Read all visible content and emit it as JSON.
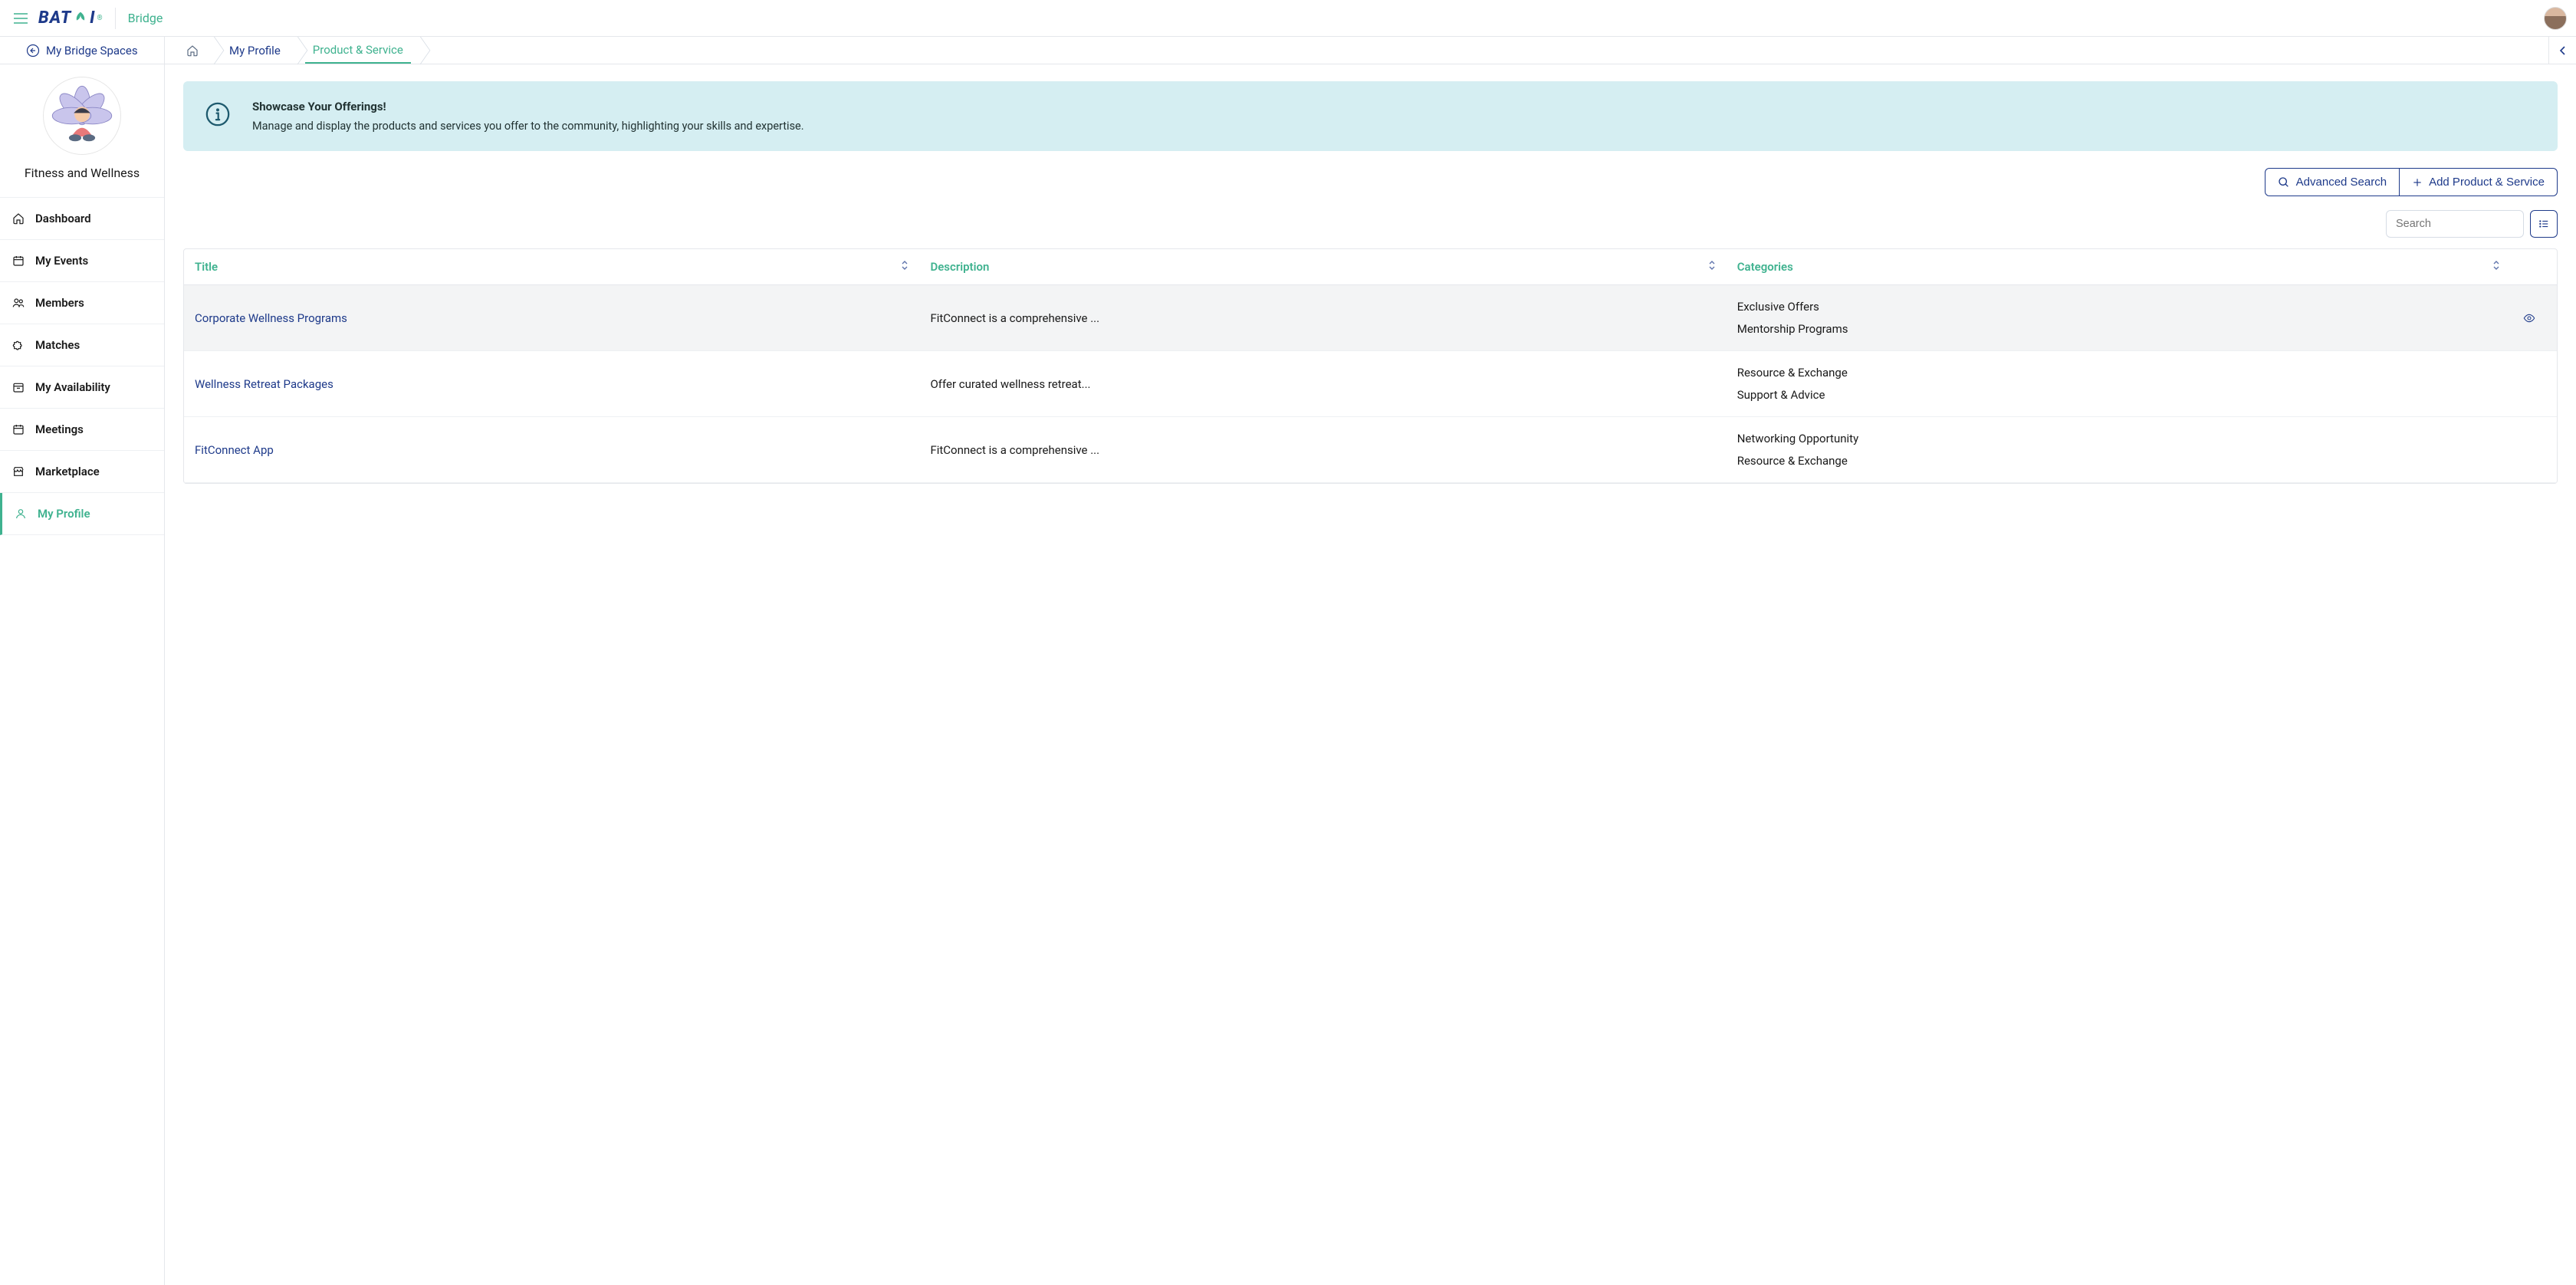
{
  "topbar": {
    "app_name": "Bridge",
    "logo_text": "BAT",
    "logo_text2": "I"
  },
  "crumbbar": {
    "back_label": "My Bridge Spaces",
    "items": [
      "My Profile",
      "Product & Service"
    ],
    "active_index": 1
  },
  "sidebar": {
    "space_title": "Fitness and Wellness",
    "items": [
      {
        "label": "Dashboard",
        "icon": "home"
      },
      {
        "label": "My Events",
        "icon": "calendar"
      },
      {
        "label": "Members",
        "icon": "users"
      },
      {
        "label": "Matches",
        "icon": "puzzle"
      },
      {
        "label": "My Availability",
        "icon": "calendar-check"
      },
      {
        "label": "Meetings",
        "icon": "calendar"
      },
      {
        "label": "Marketplace",
        "icon": "store"
      },
      {
        "label": "My Profile",
        "icon": "user"
      }
    ],
    "active_index": 7
  },
  "banner": {
    "title": "Showcase Your Offerings!",
    "text": "Manage and display the products and services you offer to the community, highlighting your skills and expertise."
  },
  "actions": {
    "advanced_search": "Advanced Search",
    "add_product": "Add Product & Service"
  },
  "search": {
    "placeholder": "Search"
  },
  "table": {
    "columns": [
      "Title",
      "Description",
      "Categories"
    ],
    "rows": [
      {
        "title": "Corporate Wellness Programs",
        "description": "FitConnect is a comprehensive ...",
        "categories": [
          "Exclusive Offers",
          "Mentorship Programs"
        ],
        "eye": true
      },
      {
        "title": "Wellness Retreat Packages",
        "description": "Offer curated wellness retreat...",
        "categories": [
          "Resource & Exchange",
          "Support & Advice"
        ],
        "eye": false
      },
      {
        "title": "FitConnect App",
        "description": "FitConnect is a comprehensive ...",
        "categories": [
          "Networking Opportunity",
          "Resource & Exchange"
        ],
        "eye": false
      }
    ]
  }
}
